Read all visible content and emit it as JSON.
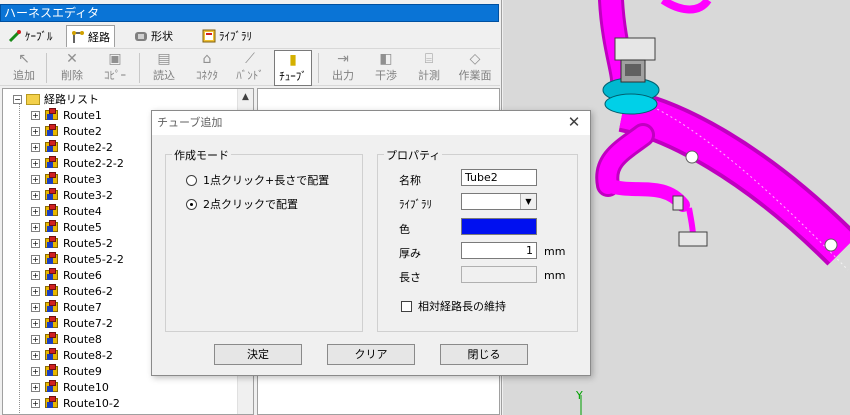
{
  "editor": {
    "title": "ハーネスエディタ",
    "tabs": [
      {
        "label": "ｹｰﾌﾞﾙ"
      },
      {
        "label": "経路"
      },
      {
        "label": "形状"
      },
      {
        "label": "ﾗｲﾌﾞﾗﾘ"
      }
    ],
    "toolbar": [
      {
        "label": "追加",
        "glyph": "↖"
      },
      {
        "label": "削除",
        "glyph": "✕"
      },
      {
        "label": "ｺﾋﾟｰ",
        "glyph": "▣"
      },
      {
        "label": "読込",
        "glyph": "▤"
      },
      {
        "label": "ｺﾈｸﾀ",
        "glyph": "⌂"
      },
      {
        "label": "ﾊﾞﾝﾄﾞ",
        "glyph": "⟋"
      },
      {
        "label": "ﾁｭｰﾌﾞ",
        "glyph": "▮"
      },
      {
        "label": "出力",
        "glyph": "⇥"
      },
      {
        "label": "干渉",
        "glyph": "◧"
      },
      {
        "label": "計測",
        "glyph": "⌸"
      },
      {
        "label": "作業面",
        "glyph": "◇"
      }
    ]
  },
  "tree": {
    "root_label": "経路リスト",
    "root_expander": "−",
    "item_expander": "+",
    "routes": [
      "Route1",
      "Route2",
      "Route2-2",
      "Route2-2-2",
      "Route3",
      "Route3-2",
      "Route4",
      "Route5",
      "Route5-2",
      "Route5-2-2",
      "Route6",
      "Route6-2",
      "Route7",
      "Route7-2",
      "Route8",
      "Route8-2",
      "Route9",
      "Route10",
      "Route10-2"
    ],
    "scroll_up": "▲"
  },
  "dialog": {
    "title": "チューブ追加",
    "close": "✕",
    "mode_group": {
      "label": "作成モード",
      "options": [
        "1点クリック+長さで配置",
        "2点クリックで配置"
      ],
      "selected_index": 1
    },
    "props_group": {
      "label": "プロパティ",
      "name_label": "名称",
      "name_value": "Tube2",
      "library_label": "ﾗｲﾌﾞﾗﾘ",
      "library_value": "",
      "library_arrow": "▼",
      "color_label": "色",
      "color_value": "#0010f0",
      "thickness_label": "厚み",
      "thickness_value": "1",
      "thickness_unit": "mm",
      "length_label": "長さ",
      "length_value": "",
      "length_unit": "mm",
      "keep_ratio_label": "相対経路長の維持",
      "keep_ratio_checked": false
    },
    "buttons": {
      "ok": "決定",
      "clear": "クリア",
      "close": "閉じる"
    }
  },
  "viewport": {
    "axis_label": "Y",
    "tube_color": "#ff00ff",
    "ring_color": "#00c8e0"
  }
}
